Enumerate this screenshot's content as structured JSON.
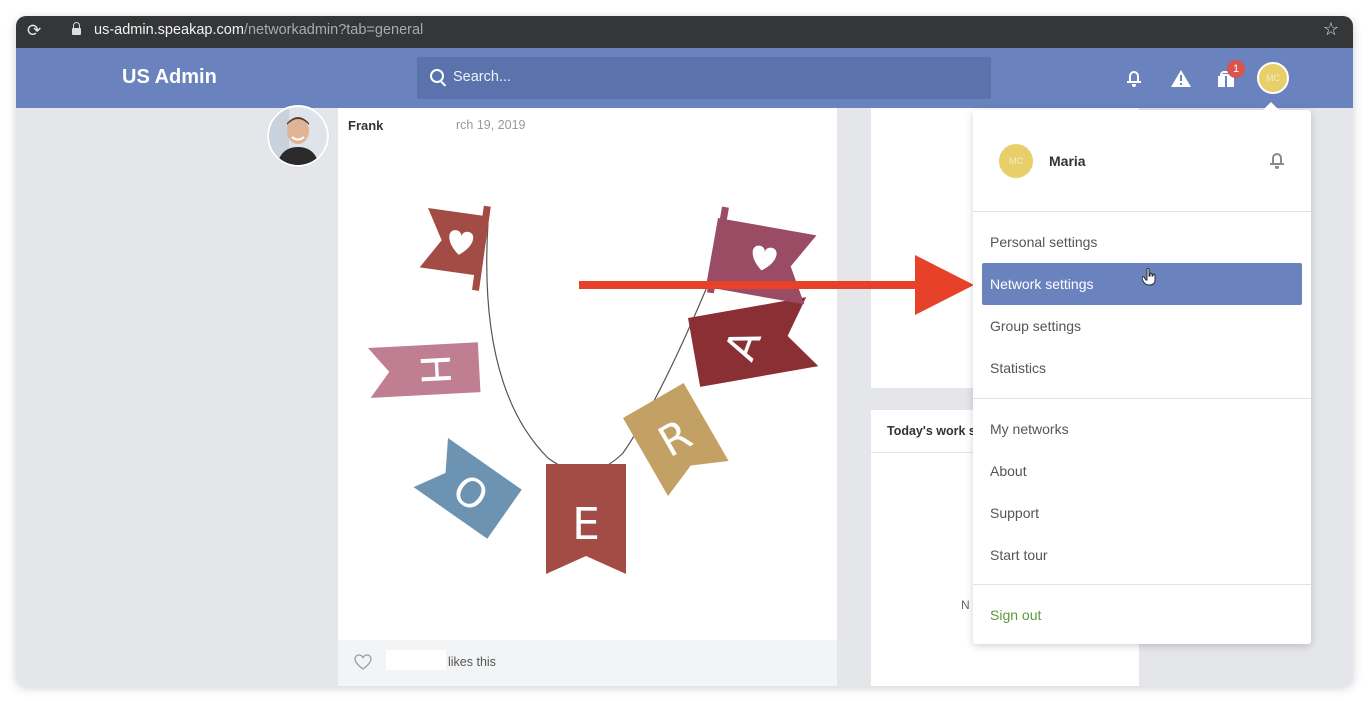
{
  "browser": {
    "url_host": "us-admin.speakap.com",
    "url_path": "/networkadmin?tab=general"
  },
  "header": {
    "brand": "US Admin",
    "search_placeholder": "Search...",
    "notification_badge": "1",
    "user_initials": "MC"
  },
  "post": {
    "author": "Frank",
    "date_fragment": "rch 19, 2019",
    "likes_text": "likes this",
    "image_letters": [
      "H",
      "O",
      "E",
      "R",
      "A"
    ]
  },
  "side_panel": {
    "work_title": "Today's work s",
    "fragment": "N"
  },
  "dropdown": {
    "user_initials": "MC",
    "user_name": "Maria",
    "menu_group_1": [
      "Personal settings",
      "Network settings",
      "Group settings",
      "Statistics"
    ],
    "menu_group_2": [
      "My networks",
      "About",
      "Support",
      "Start tour"
    ],
    "sign_out": "Sign out",
    "active_item": "Network settings"
  },
  "colors": {
    "header": "#6a82bd",
    "active_item": "#6a82bd",
    "sign_out": "#5c9a3c",
    "annotation_arrow": "#e8412a",
    "badge": "#d9534f"
  }
}
